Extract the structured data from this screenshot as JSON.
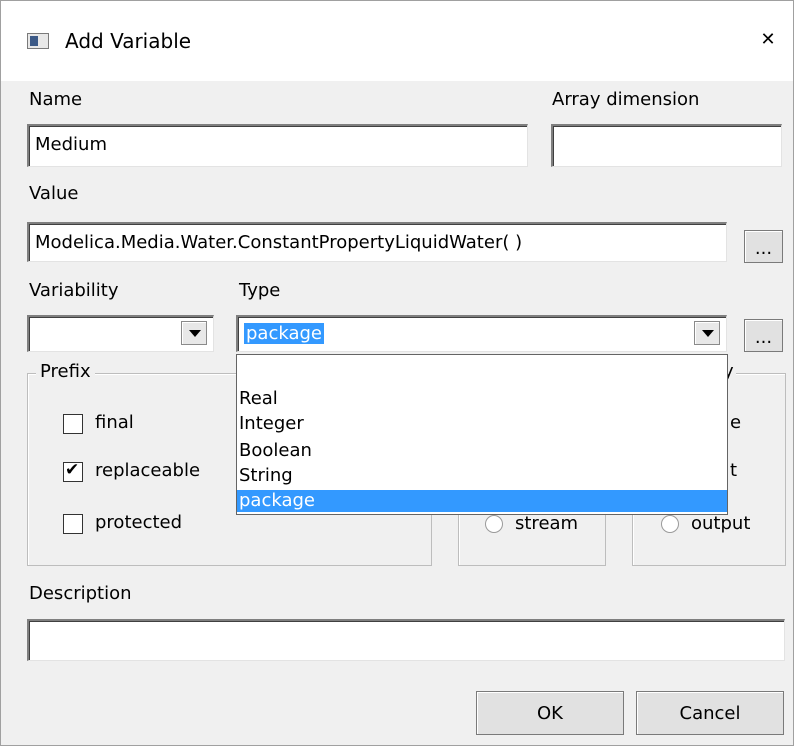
{
  "window": {
    "title": "Add Variable",
    "close_glyph": "✕"
  },
  "name": {
    "label": "Name",
    "value": "Medium"
  },
  "array_dimension": {
    "label": "Array dimension",
    "value": ""
  },
  "value": {
    "label": "Value",
    "value": "Modelica.Media.Water.ConstantPropertyLiquidWater( )",
    "browse_label": "..."
  },
  "variability": {
    "label": "Variability",
    "value": ""
  },
  "type": {
    "label": "Type",
    "value": "package",
    "browse_label": "...",
    "options": [
      "",
      "Real",
      "Integer",
      "Boolean",
      "String",
      "package"
    ],
    "selected_index": 5
  },
  "prefix": {
    "title": "Prefix",
    "final": {
      "label": "final",
      "checked": false
    },
    "replaceable": {
      "label": "replaceable",
      "checked": true
    },
    "protected": {
      "label": "protected",
      "checked": false
    }
  },
  "causality": {
    "title_fragment": "y",
    "fragment_e": "e",
    "fragment_t": "t",
    "stream_label": "stream",
    "output_label": "output"
  },
  "description": {
    "label": "Description",
    "value": ""
  },
  "buttons": {
    "ok": "OK",
    "cancel": "Cancel"
  },
  "colors": {
    "selection": "#3399ff",
    "dialog_bg": "#f0f0f0"
  },
  "icons": {
    "app": "window-icon",
    "close": "close-icon",
    "dropdown": "chevron-down-icon"
  }
}
